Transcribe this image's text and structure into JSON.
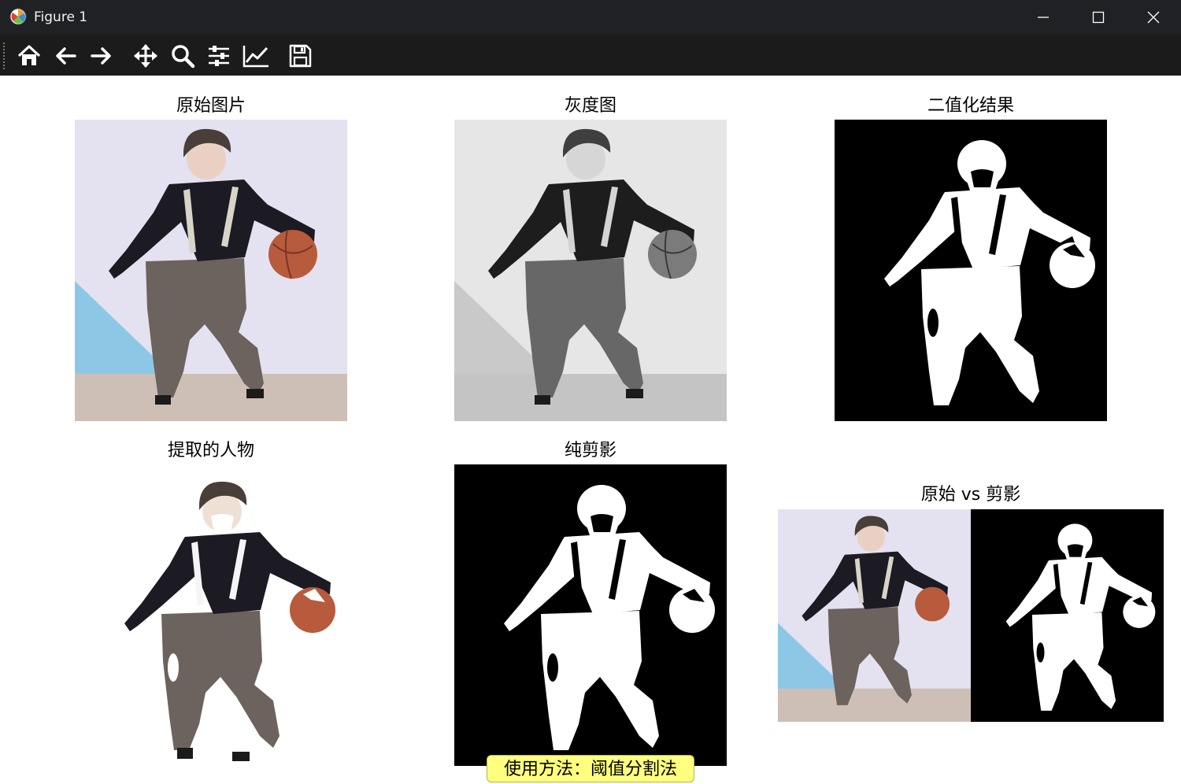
{
  "window": {
    "title": "Figure 1",
    "controls": [
      "minimize",
      "maximize",
      "close"
    ]
  },
  "toolbar": {
    "tools": [
      "home-icon",
      "back-arrow-icon",
      "forward-arrow-icon",
      "pan-icon",
      "zoom-icon",
      "subplots-config-icon",
      "edit-curves-icon",
      "save-icon"
    ]
  },
  "figure": {
    "panels": [
      {
        "title": "原始图片",
        "kind": "color photo"
      },
      {
        "title": "灰度图",
        "kind": "grayscale photo"
      },
      {
        "title": "二值化结果",
        "kind": "binary mask"
      },
      {
        "title": "提取的人物",
        "kind": "extracted subject on white"
      },
      {
        "title": "纯剪影",
        "kind": "binary mask"
      },
      {
        "title": "原始 vs 剪影",
        "kind": "side-by-side comparison"
      }
    ],
    "footer": "使用方法：阈值分割法"
  },
  "colors": {
    "titlebar": "#202124",
    "toolbar": "#1b1b1b",
    "footer_bg": "#ffff7f",
    "wall": "#e4e2f0",
    "floor": "#cdbfb6",
    "accent_triangle": "#8cc8e6",
    "ball": "#b85a3c"
  }
}
